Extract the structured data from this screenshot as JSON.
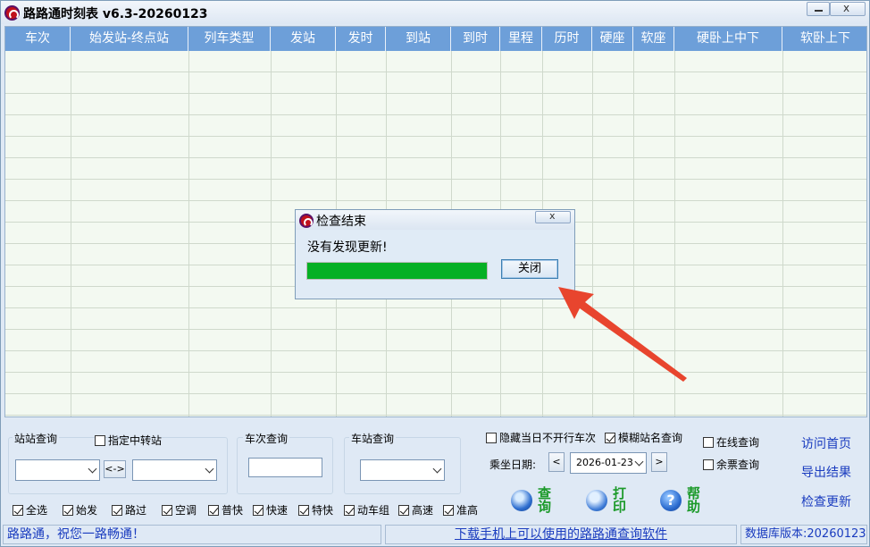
{
  "window": {
    "title": "路路通时刻表 v6.3-20260123",
    "close_glyph": "x"
  },
  "grid": {
    "columns": [
      "车次",
      "始发站-终点站",
      "列车类型",
      "发站",
      "发时",
      "到站",
      "到时",
      "里程",
      "历时",
      "硬座",
      "软座",
      "硬卧上中下",
      "软卧上下"
    ]
  },
  "dialog": {
    "title": "检查结束",
    "close_glyph": "x",
    "message": "没有发现更新!",
    "button_label": "关闭",
    "progress": 1.0,
    "progress_color": "#06b025"
  },
  "station_query": {
    "label": "站站查询",
    "transfer_checkbox": "指定中转站",
    "transfer_checked": false,
    "swap_label": "<->"
  },
  "train_query": {
    "label": "车次查询"
  },
  "stop_query": {
    "label": "车站查询"
  },
  "options": {
    "hide_nonrunning": "隐藏当日不开行车次",
    "hide_nonrunning_checked": false,
    "fuzzy_name": "模糊站名查询",
    "fuzzy_name_checked": true,
    "online_query": "在线查询",
    "online_checked": false,
    "ticket_query": "余票查询",
    "ticket_checked": false,
    "date_label": "乘坐日期:",
    "date_value": "2026-01-23",
    "prev": "<",
    "next": ">"
  },
  "filters": [
    {
      "label": "全选",
      "checked": true
    },
    {
      "label": "始发",
      "checked": true
    },
    {
      "label": "路过",
      "checked": true
    },
    {
      "label": "空调",
      "checked": true
    },
    {
      "label": "普快",
      "checked": true
    },
    {
      "label": "快速",
      "checked": true
    },
    {
      "label": "特快",
      "checked": true
    },
    {
      "label": "动车组",
      "checked": true
    },
    {
      "label": "高速",
      "checked": true
    },
    {
      "label": "准高",
      "checked": true
    }
  ],
  "actions": {
    "query": "查询",
    "print": "打印",
    "help": "帮助",
    "help_glyph": "?"
  },
  "links": {
    "home": "访问首页",
    "export": "导出结果",
    "update": "检查更新"
  },
  "status": {
    "left": "路路通，祝您一路畅通！",
    "middle": "下载手机上可以使用的路路通查询软件",
    "right": "数据库版本:20260123"
  },
  "colors": {
    "header": "#6d9fd9",
    "grid_bg": "#f3f9f1",
    "arrow": "#e8452e",
    "link": "#1a3cbf"
  }
}
